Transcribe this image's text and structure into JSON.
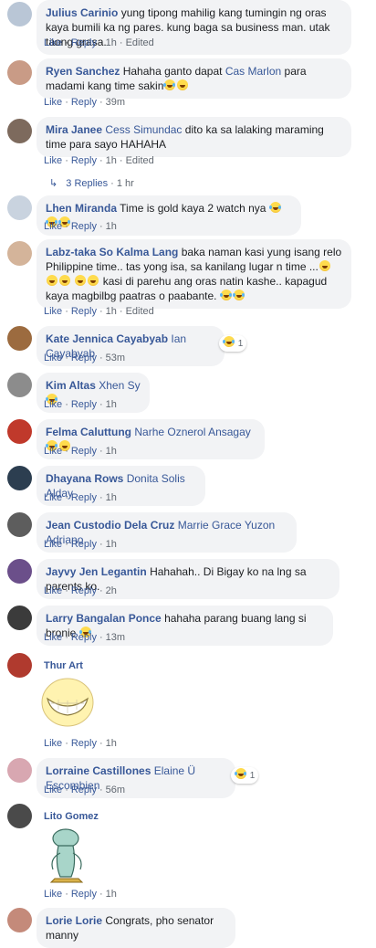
{
  "actions": {
    "like": "Like",
    "reply": "Reply",
    "edited": "Edited",
    "sep": "·"
  },
  "comments": [
    {
      "name": "Julius Carinio",
      "text": "yung tipong mahilig kang tumingin ng oras kaya bumili ka ng pares. kung baga sa business man. utak taong grasa.",
      "time": "1h",
      "edited": true
    },
    {
      "name": "Ryen Sanchez",
      "text": "Hahaha ganto dapat",
      "tag": "Cas Marlon",
      "text2": "para madami kang time sakin",
      "time": "39m"
    },
    {
      "name": "Mira Janee",
      "tag": "Cess Simundac",
      "text": "dito ka sa lalaking maraming time para sayo HAHAHA",
      "time": "1h",
      "edited": true,
      "replies": "3 Replies",
      "replies_time": "1 hr"
    },
    {
      "name": "Lhen Miranda",
      "text": "Time is gold kaya 2 watch nya",
      "time": "1h"
    },
    {
      "name": "Labz-taka So Kalma Lang",
      "text": "baka naman kasi yung isang relo Philippine time.. tas yong isa, sa kanilang lugar n time ...",
      "text2": "kasi di parehu ang oras natin kashe.. kapagud kaya magbilbg paatras o paabante.",
      "time": "1h",
      "edited": true
    },
    {
      "name": "Kate Jennica Cayabyab",
      "tag": "Ian Cayabyab",
      "time": "53m",
      "reactions": "1"
    },
    {
      "name": "Kim Altas",
      "tag": "Xhen Sy",
      "time": "1h"
    },
    {
      "name": "Felma Caluttung",
      "tag": "Narhe Oznerol Ansagay",
      "time": "1h"
    },
    {
      "name": "Dhayana Rows",
      "tag": "Donita Solis Alday",
      "time": "1h"
    },
    {
      "name": "Jean Custodio Dela Cruz",
      "tag": "Marrie Grace Yuzon Adriano",
      "time": "1h"
    },
    {
      "name": "Jayvy Jen Legantin",
      "text": "Hahahah.. Di Bigay ko na lng sa parents ko.",
      "time": "2h"
    },
    {
      "name": "Larry Bangalan Ponce",
      "text": "hahaha parang buang lang si bronie",
      "time": "13m"
    },
    {
      "name": "Thur Art",
      "time": "1h"
    },
    {
      "name": "Lorraine Castillones",
      "tag": "Elaine Ü Escombien",
      "time": "56m",
      "reactions": "1"
    },
    {
      "name": "Lito Gomez",
      "time": "1h"
    },
    {
      "name": "Lorie Lorie",
      "text": "Congrats, pho senator manny"
    }
  ],
  "colors": {
    "link": "#385898",
    "bubble": "#f2f3f5",
    "meta": "#606770"
  }
}
